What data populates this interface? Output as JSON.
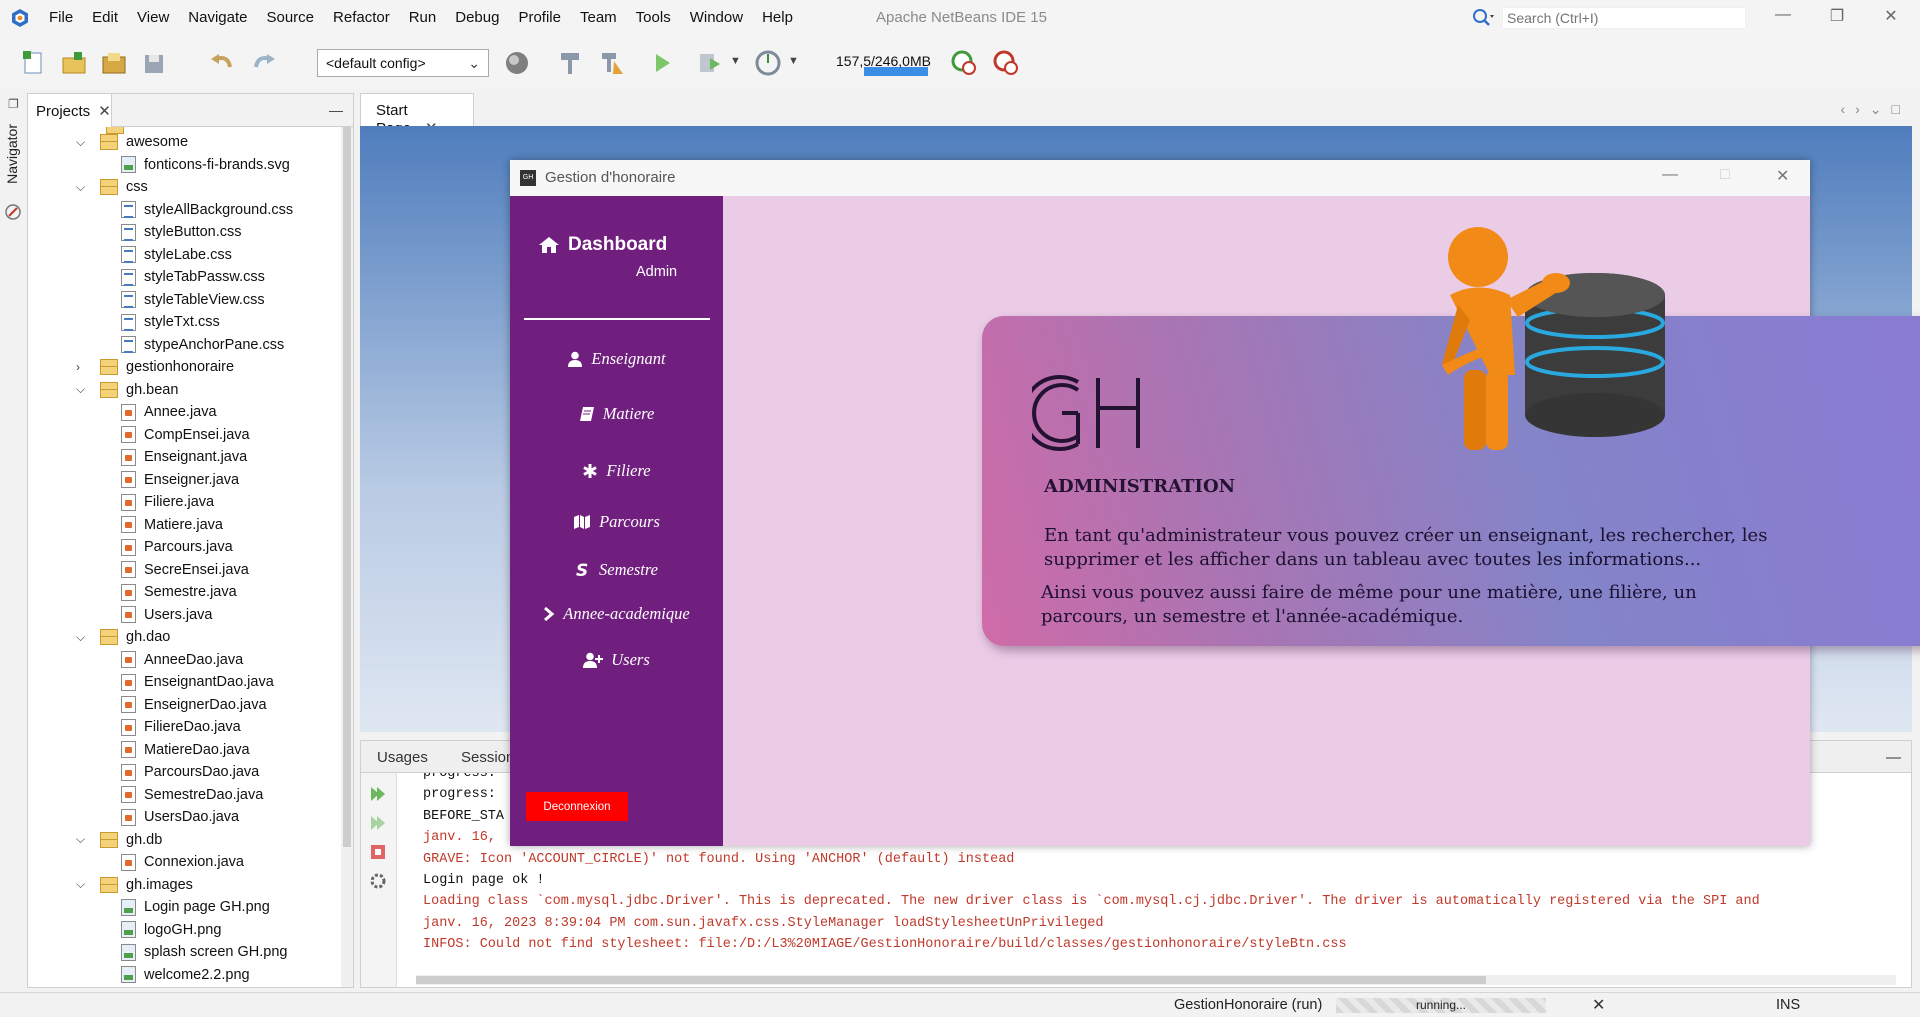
{
  "ide": {
    "title": "Apache NetBeans IDE 15",
    "menus": [
      "File",
      "Edit",
      "View",
      "Navigate",
      "Source",
      "Refactor",
      "Run",
      "Debug",
      "Profile",
      "Team",
      "Tools",
      "Window",
      "Help"
    ],
    "search_placeholder": "Search (Ctrl+I)",
    "config": "<default config>",
    "memory": "157,5/246,0MB",
    "memory_fraction": 0.64
  },
  "left": {
    "navigator_label": "Navigator",
    "projects_tab": "Projects",
    "tree": [
      {
        "label": "awesome",
        "type": "package",
        "level": 1,
        "expanded": true
      },
      {
        "label": "fonticons-fi-brands.svg",
        "type": "file-img",
        "level": 2
      },
      {
        "label": "css",
        "type": "package",
        "level": 1,
        "expanded": true
      },
      {
        "label": "styleAllBackground.css",
        "type": "file-css",
        "level": 2
      },
      {
        "label": "styleButton.css",
        "type": "file-css",
        "level": 2
      },
      {
        "label": "styleLabe.css",
        "type": "file-css",
        "level": 2
      },
      {
        "label": "styleTabPassw.css",
        "type": "file-css",
        "level": 2
      },
      {
        "label": "styleTableView.css",
        "type": "file-css",
        "level": 2
      },
      {
        "label": "styleTxt.css",
        "type": "file-css",
        "level": 2
      },
      {
        "label": "stypeAnchorPane.css",
        "type": "file-css",
        "level": 2
      },
      {
        "label": "gestionhonoraire",
        "type": "package",
        "level": 1,
        "expanded": false
      },
      {
        "label": "gh.bean",
        "type": "package",
        "level": 1,
        "expanded": true
      },
      {
        "label": "Annee.java",
        "type": "file-java",
        "level": 2
      },
      {
        "label": "CompEnsei.java",
        "type": "file-java",
        "level": 2
      },
      {
        "label": "Enseignant.java",
        "type": "file-java",
        "level": 2
      },
      {
        "label": "Enseigner.java",
        "type": "file-java",
        "level": 2
      },
      {
        "label": "Filiere.java",
        "type": "file-java",
        "level": 2
      },
      {
        "label": "Matiere.java",
        "type": "file-java",
        "level": 2
      },
      {
        "label": "Parcours.java",
        "type": "file-java",
        "level": 2
      },
      {
        "label": "SecreEnsei.java",
        "type": "file-java",
        "level": 2
      },
      {
        "label": "Semestre.java",
        "type": "file-java",
        "level": 2
      },
      {
        "label": "Users.java",
        "type": "file-java",
        "level": 2
      },
      {
        "label": "gh.dao",
        "type": "package",
        "level": 1,
        "expanded": true
      },
      {
        "label": "AnneeDao.java",
        "type": "file-java",
        "level": 2
      },
      {
        "label": "EnseignantDao.java",
        "type": "file-java",
        "level": 2
      },
      {
        "label": "EnseignerDao.java",
        "type": "file-java",
        "level": 2
      },
      {
        "label": "FiliereDao.java",
        "type": "file-java",
        "level": 2
      },
      {
        "label": "MatiereDao.java",
        "type": "file-java",
        "level": 2
      },
      {
        "label": "ParcoursDao.java",
        "type": "file-java",
        "level": 2
      },
      {
        "label": "SemestreDao.java",
        "type": "file-java",
        "level": 2
      },
      {
        "label": "UsersDao.java",
        "type": "file-java",
        "level": 2
      },
      {
        "label": "gh.db",
        "type": "package",
        "level": 1,
        "expanded": true
      },
      {
        "label": "Connexion.java",
        "type": "file-java",
        "level": 2
      },
      {
        "label": "gh.images",
        "type": "package",
        "level": 1,
        "expanded": true
      },
      {
        "label": "Login page GH.png",
        "type": "file-img",
        "level": 2
      },
      {
        "label": "logoGH.png",
        "type": "file-img",
        "level": 2
      },
      {
        "label": "splash screen GH.png",
        "type": "file-img",
        "level": 2
      },
      {
        "label": "welcome2.2.png",
        "type": "file-img",
        "level": 2
      }
    ]
  },
  "editor": {
    "tab": "Start Page"
  },
  "output": {
    "tabs": [
      "Usages",
      "Session"
    ],
    "lines": [
      {
        "text": "progress:",
        "color": "black"
      },
      {
        "text": "BEFORE_STA",
        "color": "black"
      },
      {
        "text": "janv. 16,",
        "color": "red"
      },
      {
        "text": "GRAVE: Icon 'ACCOUNT_CIRCLE)' not found. Using 'ANCHOR' (default) instead",
        "color": "red"
      },
      {
        "text": "Login page ok !",
        "color": "black"
      },
      {
        "text": "Loading class `com.mysql.jdbc.Driver'. This is deprecated. The new driver class is `com.mysql.cj.jdbc.Driver'. The driver is automatically registered via the SPI and",
        "color": "red"
      },
      {
        "text": "janv. 16, 2023 8:39:04 PM com.sun.javafx.css.StyleManager loadStylesheetUnPrivileged",
        "color": "red"
      },
      {
        "text": "INFOS: Could not find stylesheet: file:/D:/L3%20MIAGE/GestionHonoraire/build/classes/gestionhonoraire/styleBtn.css",
        "color": "red"
      }
    ]
  },
  "status": {
    "task": "GestionHonoraire (run)",
    "progress": "running...",
    "mode": "INS"
  },
  "app": {
    "window_title": "Gestion d'honoraire",
    "icon_text": "GH",
    "sidebar": {
      "title": "Dashboard",
      "subtitle": "Admin",
      "items": [
        "Enseignant",
        "Matiere",
        "Filiere",
        "Parcours",
        "Semestre",
        "Annee-academique",
        "Users"
      ],
      "logout": "Deconnexion"
    },
    "card": {
      "logo": "GH",
      "heading": "ADMINISTRATION",
      "p1": "En tant qu'administrateur vous pouvez créer un enseignant, les rechercher, les supprimer et les afficher dans un tableau avec toutes les informations...",
      "p2": "Ainsi vous pouvez aussi faire de même pour une matière, une filière, un parcours, un semestre et l'année-académique."
    },
    "colors": {
      "sidebar": "#711f7e",
      "main_bg": "#ebcce7",
      "logout": "#ff0000"
    }
  }
}
